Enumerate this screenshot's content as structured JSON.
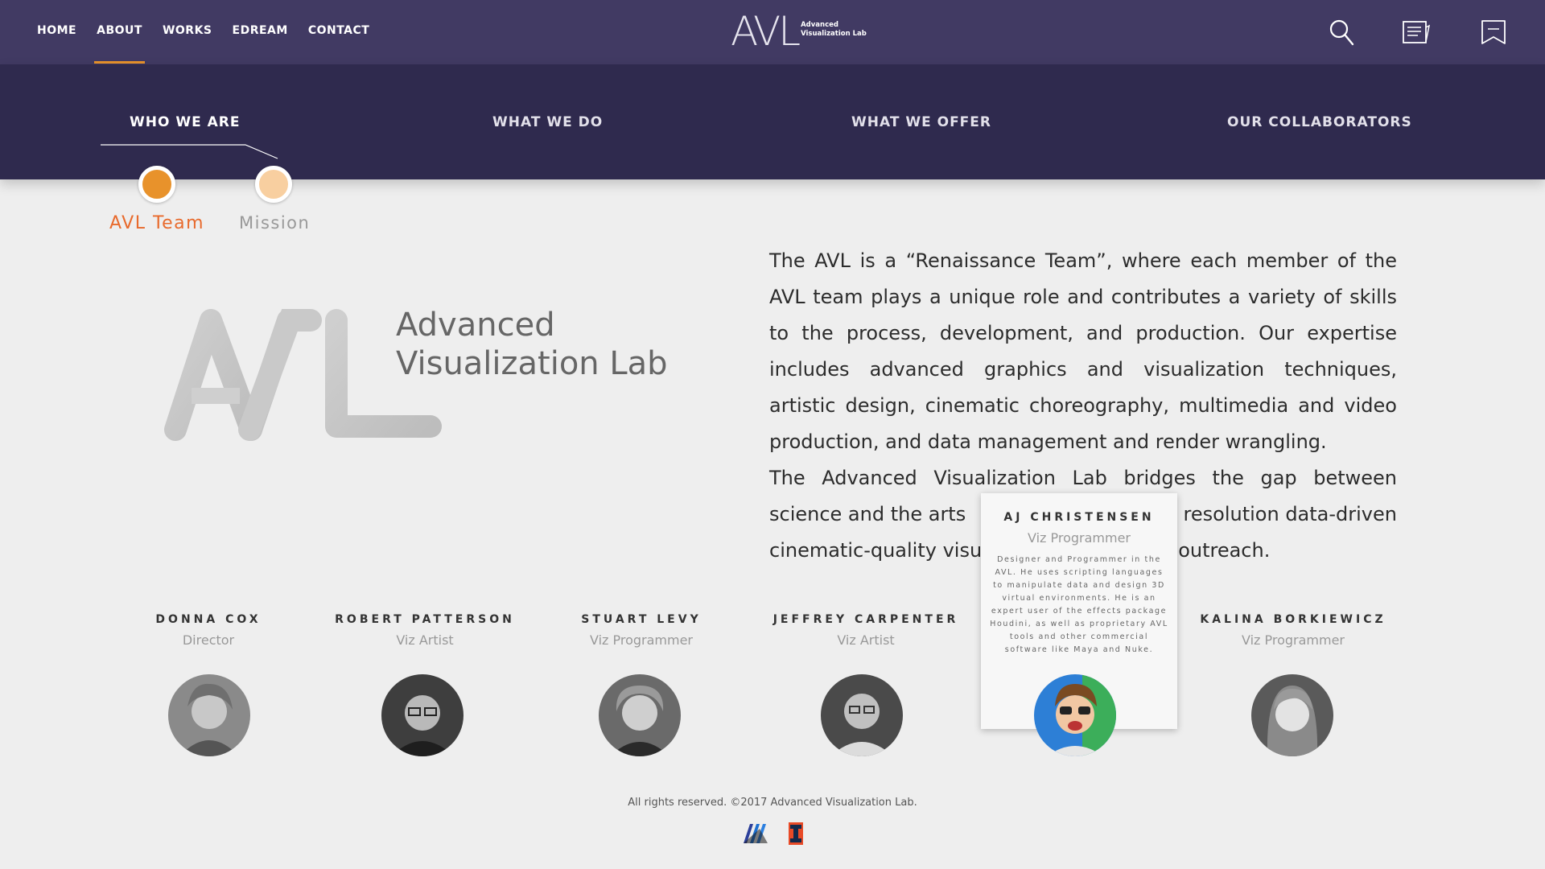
{
  "nav": {
    "links": [
      "HOME",
      "ABOUT",
      "WORKS",
      "EDREAM",
      "CONTACT"
    ],
    "active": "ABOUT",
    "logo_big": "AVL",
    "logo_small_line1": "Advanced",
    "logo_small_line2": "Visualization Lab",
    "icons": [
      "search-icon",
      "news-icon",
      "bookmark-icon"
    ]
  },
  "subnav": {
    "tabs": [
      "WHO WE ARE",
      "WHAT WE DO",
      "WHAT WE OFFER",
      "OUR COLLABORATORS"
    ],
    "active": "WHO WE ARE"
  },
  "sections": {
    "items": [
      "AVL Team",
      "Mission"
    ],
    "active": "AVL Team",
    "colors": {
      "active": "#e8922b",
      "inactive": "#f8cfa0",
      "active_label": "#e86a2c",
      "inactive_label": "#999999"
    }
  },
  "hero": {
    "logo_letters": "AVL",
    "logo_line1": "Advanced",
    "logo_line2": "Visualization Lab"
  },
  "intro": {
    "paragraph1": "The AVL is a “Renaissance Team”, where each member of the AVL team plays a unique role and contributes a variety of skills to the process, development, and production.  Our expertise includes advanced graphics and visualization techniques, artistic design, cinematic choreography, multimedia and video production, and data management and render wrangling.",
    "paragraph2_left_line1": "The Advanced Visualization Lab bridges the gap between",
    "paragraph2_line2_left": "science and the arts",
    "paragraph2_line2_right": "resolution data-driven",
    "paragraph2_line3_left": "cinematic-quality visu",
    "paragraph2_line3_right": "outreach."
  },
  "team": [
    {
      "name": "DONNA COX",
      "role": "Director"
    },
    {
      "name": "ROBERT PATTERSON",
      "role": "Viz Artist"
    },
    {
      "name": "STUART LEVY",
      "role": "Viz Programmer"
    },
    {
      "name": "JEFFREY CARPENTER",
      "role": "Viz Artist"
    },
    {
      "name": "AJ CHRISTENSEN",
      "role": "Viz Programmer",
      "description": "Designer and Programmer in the AVL. He uses scripting languages to manipulate data and design 3D virtual environments. He is an expert user of the effects package Houdini, as well as proprietary AVL tools and other commercial software like Maya and Nuke."
    },
    {
      "name": "KALINA BORKIEWICZ",
      "role": "Viz Programmer"
    }
  ],
  "footer": {
    "copyright": "All rights reserved. ©2017 Advanced Visualization Lab.",
    "logo_text": "I"
  }
}
